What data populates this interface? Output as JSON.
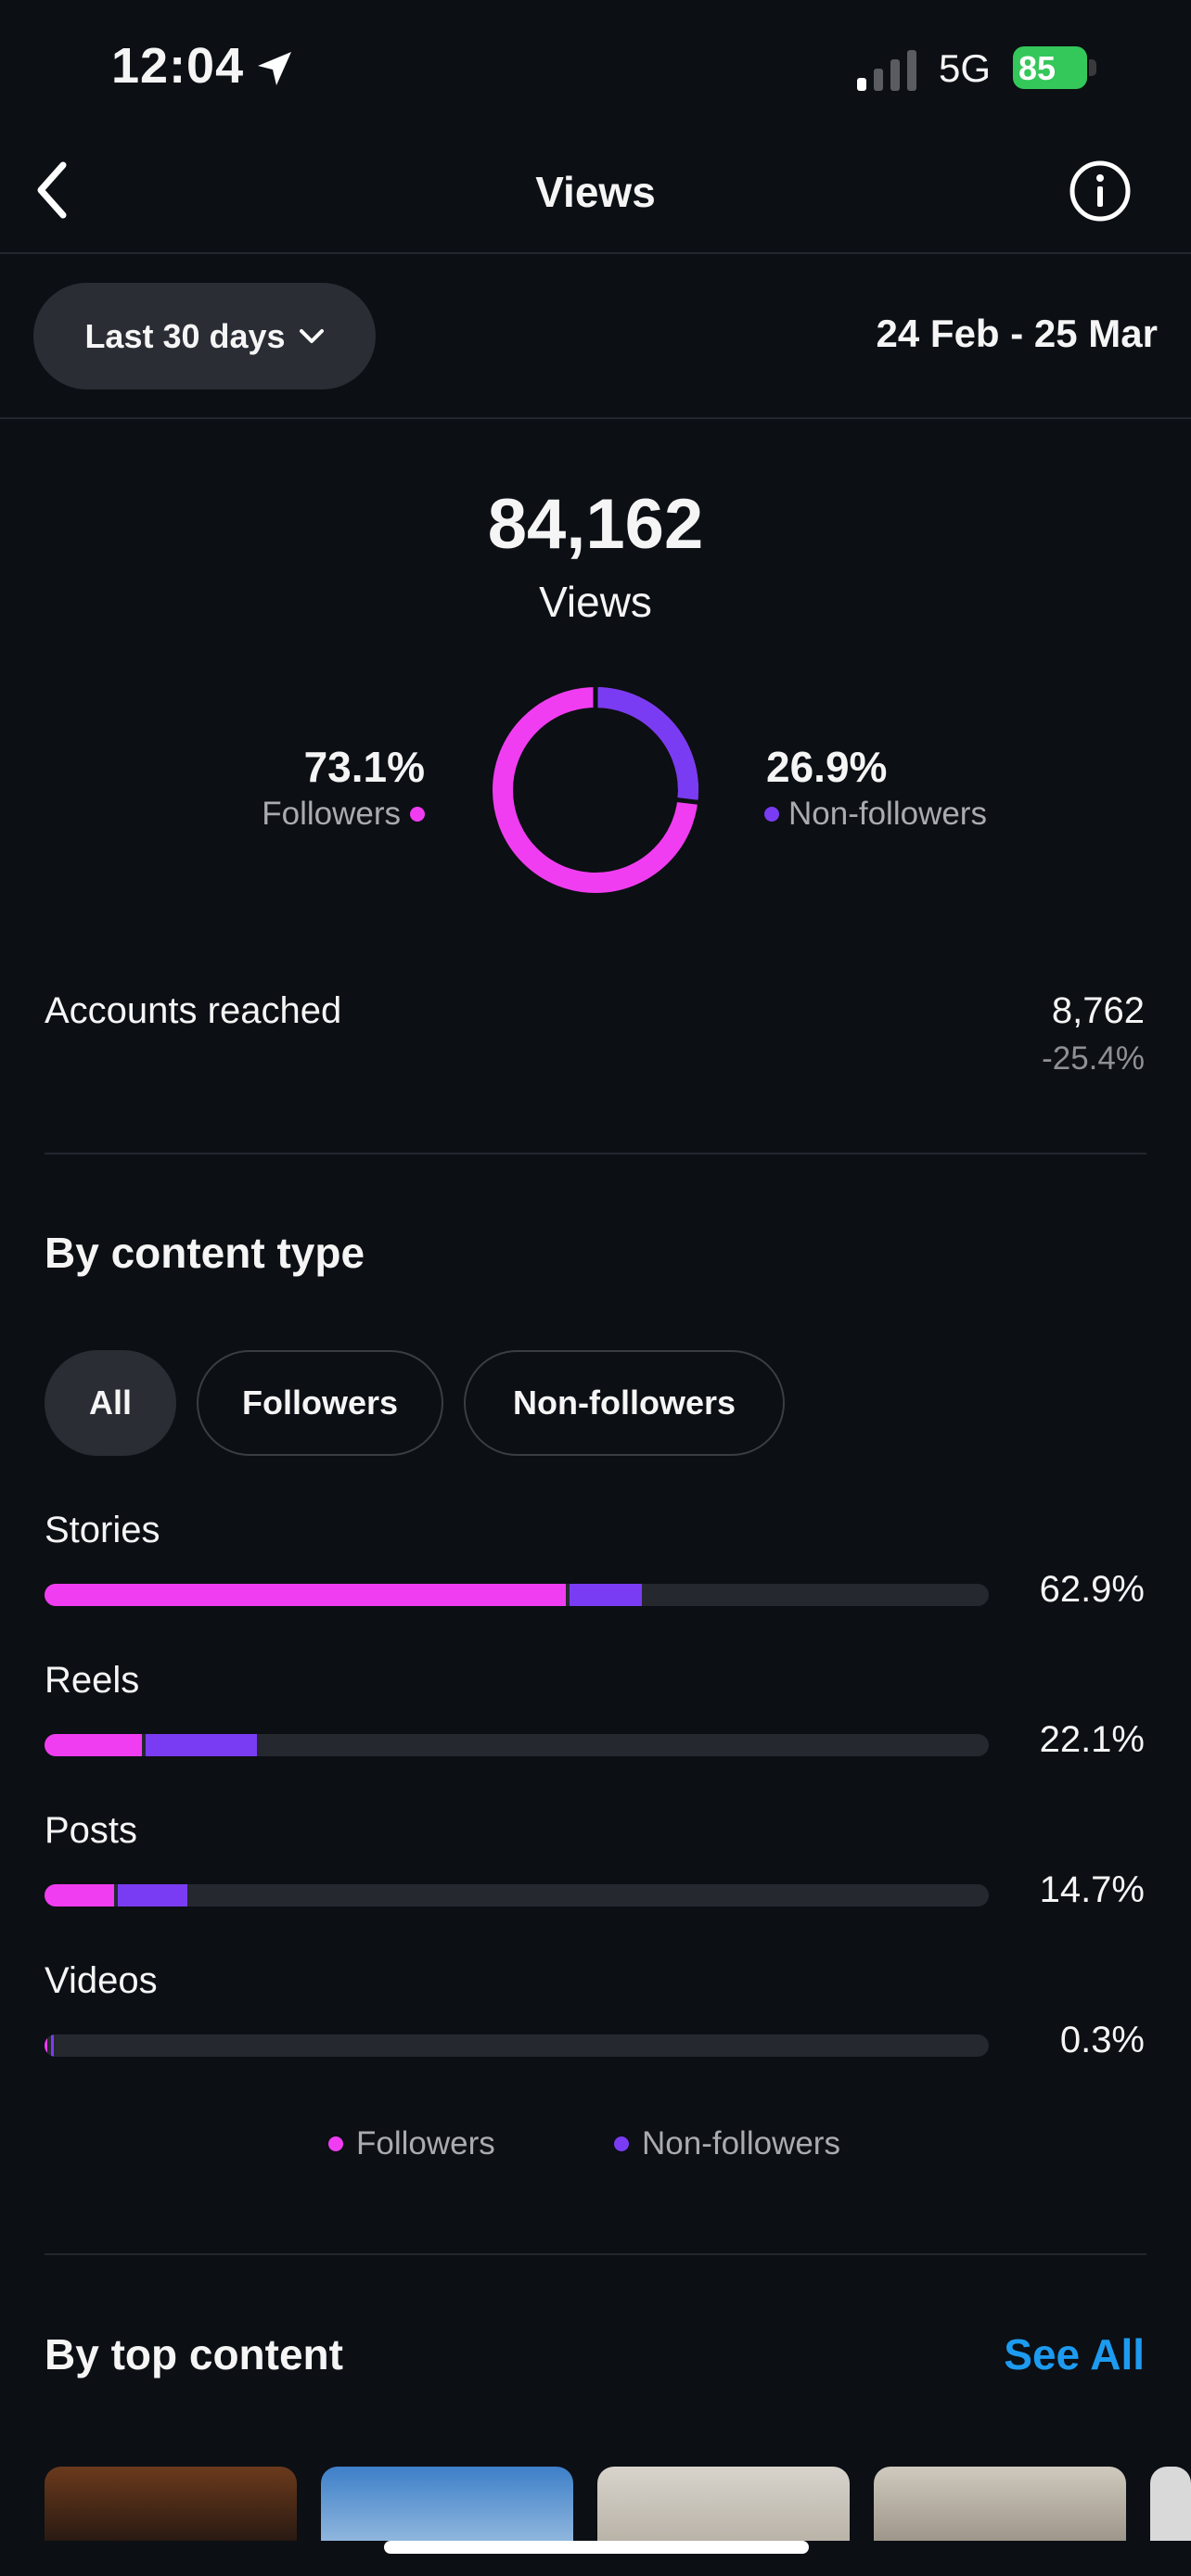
{
  "status_bar": {
    "time": "12:04",
    "network": "5G",
    "battery": "85"
  },
  "header": {
    "title": "Views",
    "back_icon": "chevron-left-icon",
    "info_icon": "info-icon"
  },
  "filter": {
    "range_label": "Last 30 days",
    "date_range": "24 Feb - 25 Mar"
  },
  "summary": {
    "views": "84,162",
    "views_label": "Views",
    "followers_pct": "73.1%",
    "followers_label": "Followers",
    "nonfollowers_pct": "26.9%",
    "nonfollowers_label": "Non-followers"
  },
  "reach": {
    "label": "Accounts reached",
    "value": "8,762",
    "change": "-25.4%"
  },
  "content_type": {
    "title": "By content type",
    "chips": [
      "All",
      "Followers",
      "Non-followers"
    ],
    "active_chip": "All",
    "rows": [
      {
        "label": "Stories",
        "pct": "62.9%"
      },
      {
        "label": "Reels",
        "pct": "22.1%"
      },
      {
        "label": "Posts",
        "pct": "14.7%"
      },
      {
        "label": "Videos",
        "pct": "0.3%"
      }
    ],
    "legend": {
      "followers": "Followers",
      "nonfollowers": "Non-followers"
    }
  },
  "top_content": {
    "title": "By top content",
    "see_all": "See All"
  },
  "colors": {
    "followers": "#f13df1",
    "nonfollowers": "#7a3cf2",
    "link": "#1d9bf0",
    "battery": "#34c759"
  },
  "chart_data": {
    "type": "bar",
    "categories": [
      "Stories",
      "Reels",
      "Posts",
      "Videos"
    ],
    "series": [
      {
        "name": "Followers",
        "values": [
          55.2,
          10.3,
          7.4,
          0.1
        ]
      },
      {
        "name": "Non-followers",
        "values": [
          7.7,
          11.8,
          7.3,
          0.2
        ]
      }
    ],
    "totals": [
      62.9,
      22.1,
      14.7,
      0.3
    ],
    "donut": {
      "Followers": 73.1,
      "Non-followers": 26.9
    }
  }
}
